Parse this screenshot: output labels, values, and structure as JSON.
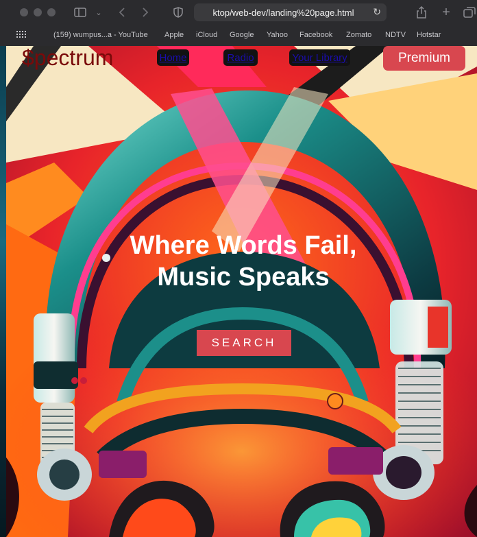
{
  "browser": {
    "url": "ktop/web-dev/landing%20page.html",
    "favorites": [
      "(159) wumpus...a - YouTube",
      "Apple",
      "iCloud",
      "Google",
      "Yahoo",
      "Facebook",
      "Zomato",
      "NDTV",
      "Hotstar"
    ]
  },
  "site": {
    "brand": "$pectrum",
    "nav": [
      "Home",
      "Radio",
      "Your Library"
    ],
    "premium_label": "Premium",
    "hero_title": "Where Words Fail, Music Speaks",
    "search_label": "SEARCH"
  }
}
